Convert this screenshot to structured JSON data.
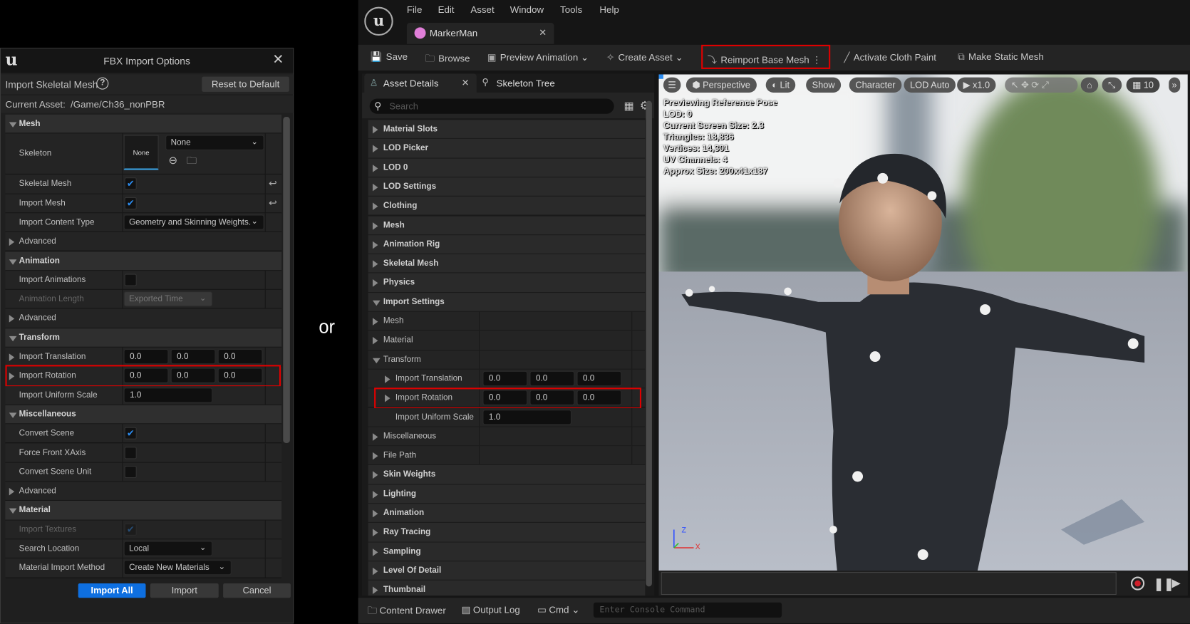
{
  "dialog": {
    "title": "FBX Import Options",
    "subtitle": "Import Skeletal Mesh",
    "reset_label": "Reset to Default",
    "current_asset_label": "Current Asset:",
    "current_asset_value": "/Game/Ch36_nonPBR",
    "skeleton_thumb": "None",
    "rows": [
      {
        "type": "hdr",
        "label": "Mesh"
      },
      {
        "type": "skeleton",
        "label": "Skeleton",
        "value": "None"
      },
      {
        "type": "prop",
        "label": "Skeletal Mesh",
        "kind": "check",
        "checked": true,
        "reset": true
      },
      {
        "type": "prop",
        "label": "Import Mesh",
        "kind": "check",
        "checked": true,
        "reset": true
      },
      {
        "type": "prop",
        "label": "Import Content Type",
        "kind": "dropdown",
        "value": "Geometry and Skinning Weights."
      },
      {
        "type": "adv",
        "label": "Advanced"
      },
      {
        "type": "hdr",
        "label": "Animation"
      },
      {
        "type": "prop",
        "label": "Import Animations",
        "kind": "check",
        "checked": false
      },
      {
        "type": "prop",
        "label": "Animation Length",
        "kind": "dropdown",
        "value": "Exported Time",
        "disabled": true
      },
      {
        "type": "adv",
        "label": "Advanced"
      },
      {
        "type": "hdr",
        "label": "Transform"
      },
      {
        "type": "vec",
        "label": "Import Translation",
        "values": [
          "0.0",
          "0.0",
          "0.0"
        ]
      },
      {
        "type": "vec",
        "label": "Import Rotation",
        "values": [
          "0.0",
          "0.0",
          "0.0"
        ],
        "highlight": true
      },
      {
        "type": "prop",
        "label": "Import Uniform Scale",
        "kind": "num",
        "value": "1.0"
      },
      {
        "type": "hdr",
        "label": "Miscellaneous"
      },
      {
        "type": "prop",
        "label": "Convert Scene",
        "kind": "check",
        "checked": true
      },
      {
        "type": "prop",
        "label": "Force Front XAxis",
        "kind": "check",
        "checked": false
      },
      {
        "type": "prop",
        "label": "Convert Scene Unit",
        "kind": "check",
        "checked": false
      },
      {
        "type": "adv",
        "label": "Advanced"
      },
      {
        "type": "hdr",
        "label": "Material"
      },
      {
        "type": "prop",
        "label": "Import Textures",
        "kind": "check",
        "checked": true,
        "disabled": true
      },
      {
        "type": "prop",
        "label": "Search Location",
        "kind": "dropdown",
        "value": "Local"
      },
      {
        "type": "prop",
        "label": "Material Import Method",
        "kind": "dropdown",
        "value": "Create New Materials"
      }
    ],
    "buttons": {
      "import_all": "Import All",
      "import": "Import",
      "cancel": "Cancel"
    }
  },
  "separator_text": "or",
  "editor": {
    "menu": [
      "File",
      "Edit",
      "Asset",
      "Window",
      "Tools",
      "Help"
    ],
    "tab": "MarkerMan",
    "toolbar": [
      "Save",
      "Browse",
      "Preview Animation",
      "Create Asset",
      "Reimport Base Mesh",
      "Activate Cloth Paint",
      "Make Static Mesh"
    ],
    "panel_tabs": [
      "Asset Details",
      "Skeleton Tree"
    ],
    "search_placeholder": "Search",
    "details_rows": [
      {
        "label": "Material Slots"
      },
      {
        "label": "LOD Picker"
      },
      {
        "label": "LOD 0"
      },
      {
        "label": "LOD Settings"
      },
      {
        "label": "Clothing"
      },
      {
        "label": "Mesh"
      },
      {
        "label": "Animation Rig"
      },
      {
        "label": "Skeletal Mesh"
      },
      {
        "label": "Physics"
      },
      {
        "label": "Import Settings",
        "expanded": true
      },
      {
        "label": "Mesh",
        "sub": 1
      },
      {
        "label": "Material",
        "sub": 1
      },
      {
        "label": "Transform",
        "sub": 1,
        "expanded": true
      },
      {
        "label": "Import Translation",
        "sub": 2,
        "values": [
          "0.0",
          "0.0",
          "0.0"
        ]
      },
      {
        "label": "Import Rotation",
        "sub": 2,
        "values": [
          "0.0",
          "0.0",
          "0.0"
        ],
        "highlight": true
      },
      {
        "label": "Import Uniform Scale",
        "sub": 2,
        "noarrow": true,
        "values": [
          "1.0"
        ]
      },
      {
        "label": "Miscellaneous",
        "sub": 1
      },
      {
        "label": "File Path",
        "sub": 1
      },
      {
        "label": "Skin Weights"
      },
      {
        "label": "Lighting"
      },
      {
        "label": "Animation"
      },
      {
        "label": "Ray Tracing"
      },
      {
        "label": "Sampling"
      },
      {
        "label": "Level Of Detail"
      },
      {
        "label": "Thumbnail"
      }
    ],
    "viewport": {
      "pills": [
        "Perspective",
        "Lit",
        "Show",
        "Character",
        "LOD Auto",
        "x1.0",
        "10"
      ],
      "stats": [
        "Previewing Reference Pose",
        "LOD: 0",
        "Current Screen Size: 2.3",
        "Triangles: 18,836",
        "Vertices: 14,301",
        "UV Channels: 4",
        "Approx Size: 200x41x187"
      ],
      "axis_x": "X",
      "axis_z": "Z"
    },
    "statusbar": {
      "content_drawer": "Content Drawer",
      "output_log": "Output Log",
      "cmd": "Cmd",
      "console_placeholder": "Enter Console Command"
    },
    "colors": {
      "highlight": "#e00000",
      "primary": "#0e6fe0",
      "record": "#d0202a"
    }
  }
}
